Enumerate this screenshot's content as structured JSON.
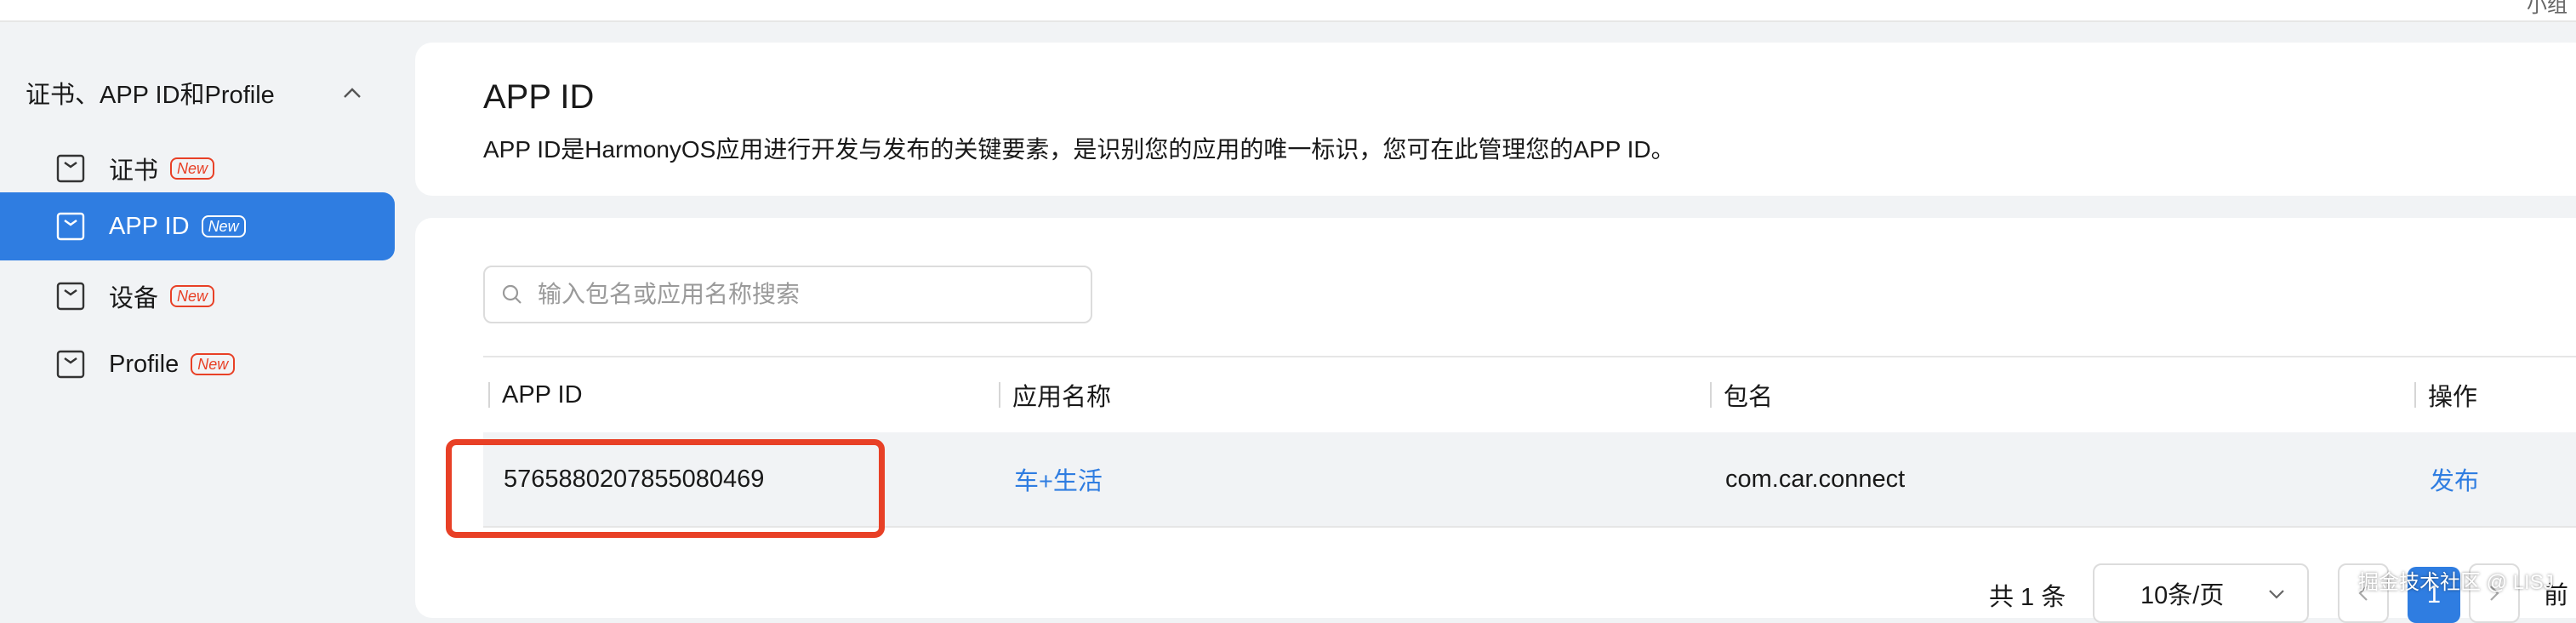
{
  "topbar": {
    "right_text": "小组"
  },
  "sidebar": {
    "group_label": "证书、APP ID和Profile",
    "items": [
      {
        "label": "证书",
        "badge": "New",
        "icon": "certificate-icon"
      },
      {
        "label": "APP ID",
        "badge": "New",
        "icon": "app-id-icon",
        "active": true
      },
      {
        "label": "设备",
        "badge": "New",
        "icon": "device-icon"
      },
      {
        "label": "Profile",
        "badge": "New",
        "icon": "profile-icon"
      }
    ]
  },
  "header": {
    "title": "APP ID",
    "description": "APP ID是HarmonyOS应用进行开发与发布的关键要素，是识别您的应用的唯一标识，您可在此管理您的APP ID。"
  },
  "search": {
    "placeholder": "输入包名或应用名称搜索",
    "value": ""
  },
  "table": {
    "columns": [
      "APP ID",
      "应用名称",
      "包名",
      "操作"
    ],
    "rows": [
      {
        "app_id": "5765880207855080469",
        "app_name": "车+生活",
        "package": "com.car.connect",
        "action": "发布"
      }
    ]
  },
  "pagination": {
    "total": "共 1 条",
    "page_size": "10条/页",
    "current_page": "1",
    "goto": "前"
  },
  "watermark": "掘金技术社区 @ LISJ",
  "colors": {
    "accent": "#2f7de1",
    "badge": "#e84026",
    "highlight": "#e84026"
  }
}
